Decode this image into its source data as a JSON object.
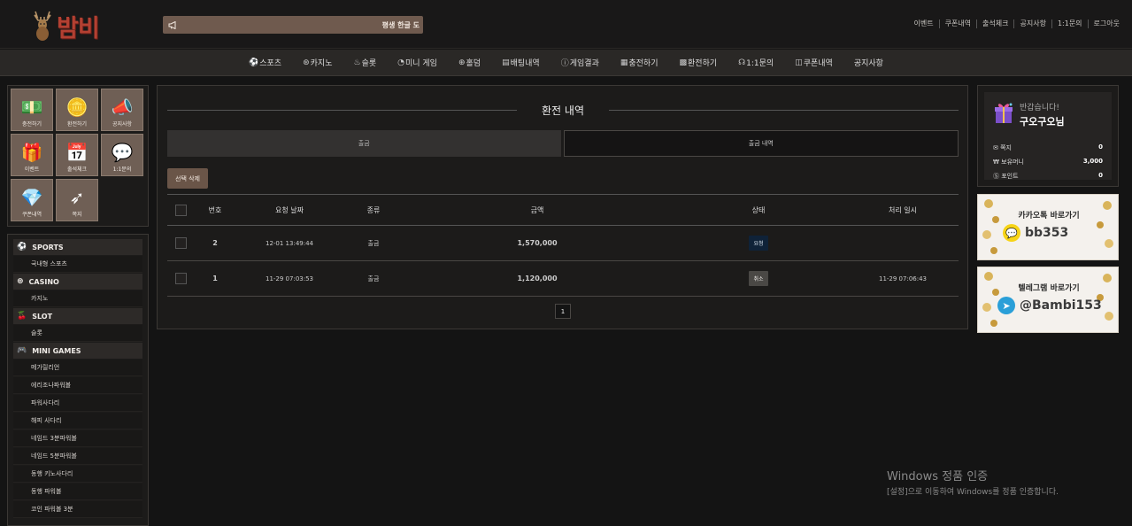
{
  "header": {
    "logo_text": "밤비",
    "notice_text": "평생 한글 도",
    "links": [
      "이벤트",
      "쿠폰내역",
      "출석체크",
      "공지사항",
      "1:1문의",
      "로그아웃"
    ]
  },
  "nav": [
    {
      "icon": "soccer-ball",
      "glyph": "⚽",
      "label": "스포츠"
    },
    {
      "icon": "chip",
      "glyph": "⊛",
      "label": "카지노"
    },
    {
      "icon": "slot",
      "glyph": "♨",
      "label": "슬롯"
    },
    {
      "icon": "clock",
      "glyph": "◔",
      "label": "미니 게임"
    },
    {
      "icon": "hold",
      "glyph": "⊕",
      "label": "홀덤"
    },
    {
      "icon": "ticket",
      "glyph": "▤",
      "label": "배팅내역"
    },
    {
      "icon": "info",
      "glyph": "ⓘ",
      "label": "게임결과"
    },
    {
      "icon": "deposit",
      "glyph": "▦",
      "label": "충전하기"
    },
    {
      "icon": "exchange",
      "glyph": "▩",
      "label": "환전하기"
    },
    {
      "icon": "headset",
      "glyph": "☊",
      "label": "1:1문의"
    },
    {
      "icon": "coupon",
      "glyph": "◫",
      "label": "쿠폰내역"
    },
    {
      "icon": "none",
      "glyph": "",
      "label": "공지사항"
    }
  ],
  "quick_menu": [
    {
      "icon": "cash-stack",
      "glyph": "💵",
      "label": "충전하기"
    },
    {
      "icon": "coin",
      "glyph": "🪙",
      "label": "환전하기"
    },
    {
      "icon": "megaphone",
      "glyph": "📣",
      "label": "공지사항"
    },
    {
      "icon": "gift-box",
      "glyph": "🎁",
      "label": "이벤트"
    },
    {
      "icon": "calendar-heart",
      "glyph": "📅",
      "label": "출석체크"
    },
    {
      "icon": "chat-bubble",
      "glyph": "💬",
      "label": "1:1문의"
    },
    {
      "icon": "diamond",
      "glyph": "💎",
      "label": "쿠폰내역"
    },
    {
      "icon": "cursor-arrow",
      "glyph": "➶",
      "label": "쪽지"
    }
  ],
  "side_menu": [
    {
      "category": "SPORTS",
      "icon": "soccer-ball",
      "glyph": "⚽",
      "items": [
        "국내형 스포츠"
      ]
    },
    {
      "category": "CASINO",
      "icon": "chip",
      "glyph": "⊛",
      "items": [
        "카지노"
      ]
    },
    {
      "category": "SLOT",
      "icon": "cherries",
      "glyph": "🍒",
      "items": [
        "슬롯"
      ]
    },
    {
      "category": "MINI GAMES",
      "icon": "gamepad",
      "glyph": "🎮",
      "items": [
        "메가릴리언",
        "에리조나파워볼",
        "파워사다리",
        "해피 사다리",
        "네임드 3분파워볼",
        "네임드 5분파워볼",
        "동행 키노사다리",
        "동행 파워볼",
        "코인 파워볼 3분"
      ]
    }
  ],
  "main": {
    "title": "환전 내역",
    "tabs": [
      "출금",
      "출금 내역"
    ],
    "delete_button": "선택 삭제",
    "columns": [
      "번호",
      "요청 날짜",
      "종류",
      "금액",
      "상태",
      "처리 일시"
    ],
    "rows": [
      {
        "no": "2",
        "date": "12-01 13:49:44",
        "kind": "출금",
        "amount": "1,570,000",
        "status": "요청",
        "status_type": "req",
        "processed": ""
      },
      {
        "no": "1",
        "date": "11-29 07:03:53",
        "kind": "출금",
        "amount": "1,120,000",
        "status": "취소",
        "status_type": "cancel",
        "processed": "11-29 07:06:43"
      }
    ],
    "page": "1"
  },
  "profile": {
    "greeting": "반갑습니다!",
    "username": "구오구오님",
    "rows": [
      {
        "icon": "envelope",
        "glyph": "✉",
        "label": "쪽지",
        "value": "0"
      },
      {
        "icon": "won",
        "glyph": "₩",
        "label": "보유머니",
        "value": "3,000"
      },
      {
        "icon": "points",
        "glyph": "Ⓢ",
        "label": "포인트",
        "value": "0"
      }
    ]
  },
  "banners": [
    {
      "title": "카카오톡 바로가기",
      "handle": "bb353",
      "icon": "kakao-talk",
      "glyph": "💬",
      "color": "#f7d417"
    },
    {
      "title": "텔레그램 바로가기",
      "handle": "@Bambi153",
      "icon": "telegram",
      "glyph": "➤",
      "color": "#2a9fd8"
    }
  ],
  "watermark": {
    "line1": "Windows 정품 인증",
    "line2": "[설정]으로 이동하여 Windows를 정품 인증합니다."
  }
}
